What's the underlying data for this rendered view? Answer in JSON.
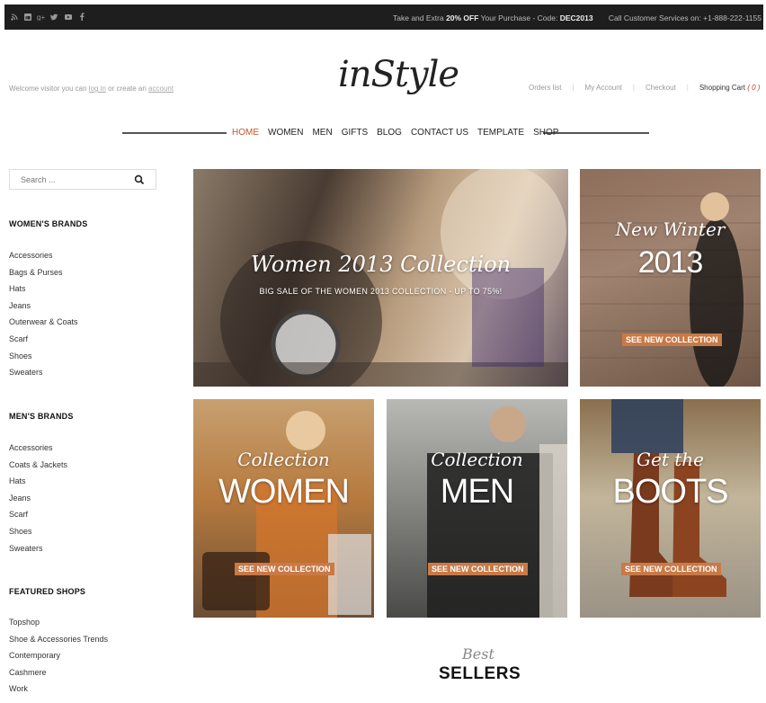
{
  "topbar": {
    "social_icons": [
      "rss-icon",
      "linkedin-icon",
      "google-plus-icon",
      "twitter-icon",
      "youtube-icon",
      "facebook-icon"
    ],
    "promo_prefix": "Take and Extra ",
    "promo_highlight": "20% OFF",
    "promo_middle": " Your Purchase - Code: ",
    "promo_code": "DEC2013",
    "phone": "Call Customer Services on: +1-888-222-1155"
  },
  "header": {
    "welcome_prefix": "Welcome visitor you can ",
    "login_link": "log in",
    "welcome_middle": " or create an ",
    "account_link": "account",
    "logo": "inStyle",
    "links": {
      "orders": "Orders list",
      "account": "My Account",
      "checkout": "Checkout",
      "cart": "Shopping Cart",
      "cart_count": "( 0 )"
    },
    "separator": "|"
  },
  "nav": [
    "HOME",
    "WOMEN",
    "MEN",
    "GIFTS",
    "BLOG",
    "CONTACT US",
    "TEMPLATE",
    "SHOP"
  ],
  "sidebar": {
    "search_placeholder": "Search ...",
    "womens_title": "WOMEN'S BRANDS",
    "womens": [
      "Accessories",
      "Bags & Purses",
      "Hats",
      "Jeans",
      "Outerwear & Coats",
      "Scarf",
      "Shoes",
      "Sweaters"
    ],
    "mens_title": "MEN'S BRANDS",
    "mens": [
      "Accessories",
      "Coats & Jackets",
      "Hats",
      "Jeans",
      "Scarf",
      "Shoes",
      "Sweaters"
    ],
    "featured_title": "FEATURED SHOPS",
    "featured": [
      "Topshop",
      "Shoe & Accessories Trends",
      "Contemporary",
      "Cashmere",
      "Work"
    ]
  },
  "banners": {
    "main_script": "Women 2013 Collection",
    "main_sub": "BIG SALE OF THE WOMEN 2013 COLLECTION - UP TO 75%!",
    "winter_script": "New Winter",
    "winter_big": "2013",
    "collection_script": "Collection",
    "women_big": "WOMEN",
    "men_big": "MEN",
    "boots_script": "Get the",
    "boots_big": "BOOTS",
    "cta": "SEE NEW COLLECTION"
  },
  "best": {
    "small": "Best",
    "big": "SELLERS"
  },
  "colors": {
    "accent": "#c0562b",
    "button": "#c87a47",
    "topbar": "#1e1e1e"
  }
}
